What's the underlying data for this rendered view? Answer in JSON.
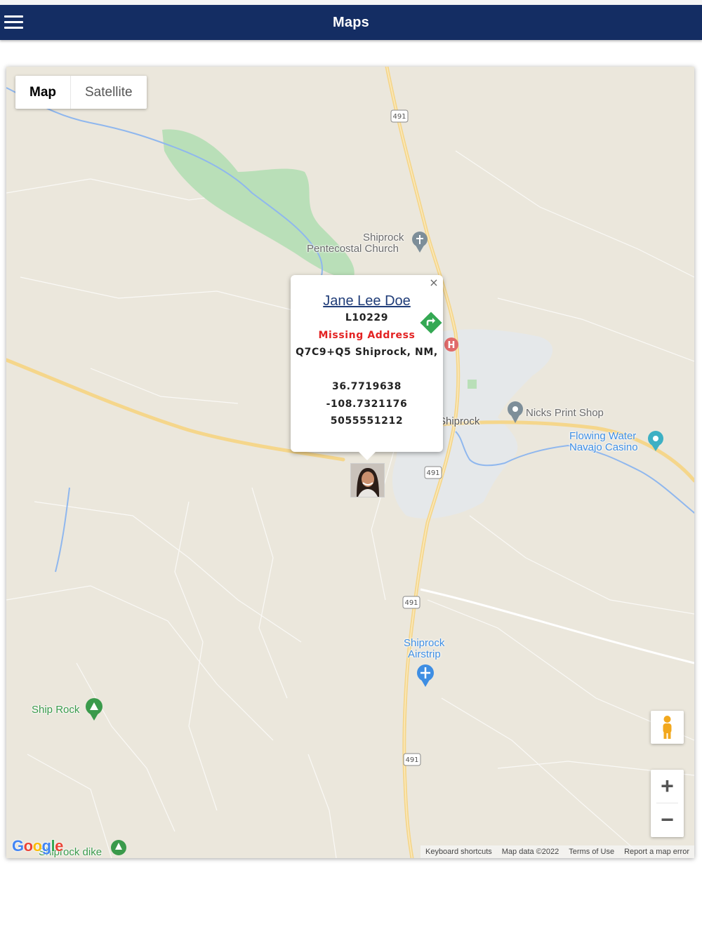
{
  "header": {
    "title": "Maps",
    "menu_icon": "hamburger-menu-icon",
    "bg_color": "#142d63"
  },
  "map_type": {
    "map_label": "Map",
    "satellite_label": "Satellite",
    "selected": "Map"
  },
  "places": {
    "church_line1": "Shiprock",
    "church_line2": "Pentecostal Church",
    "town": "Shiprock",
    "print_shop": "Nicks Print Shop",
    "casino_line1": "Flowing Water",
    "casino_line2": "Navajo Casino",
    "airstrip_line1": "Shiprock",
    "airstrip_line2": "Airstrip",
    "ship_rock": "Ship Rock",
    "dike": "Shiprock dike",
    "route": "491"
  },
  "popup": {
    "name": "Jane Lee Doe",
    "id": "L10229",
    "status": "Missing Address",
    "address": "Q7C9+Q5 Shiprock, NM,",
    "latitude": "36.7719638",
    "longitude": "-108.7321176",
    "phone": "5055551212",
    "close_label": "×",
    "status_color": "#e32222"
  },
  "controls": {
    "zoom_in": "+",
    "zoom_out": "−",
    "pegman_icon": "pegman-icon"
  },
  "attribution": {
    "logo": "Google",
    "shortcuts": "Keyboard shortcuts",
    "map_data": "Map data ©2022",
    "terms": "Terms of Use",
    "report": "Report a map error"
  }
}
